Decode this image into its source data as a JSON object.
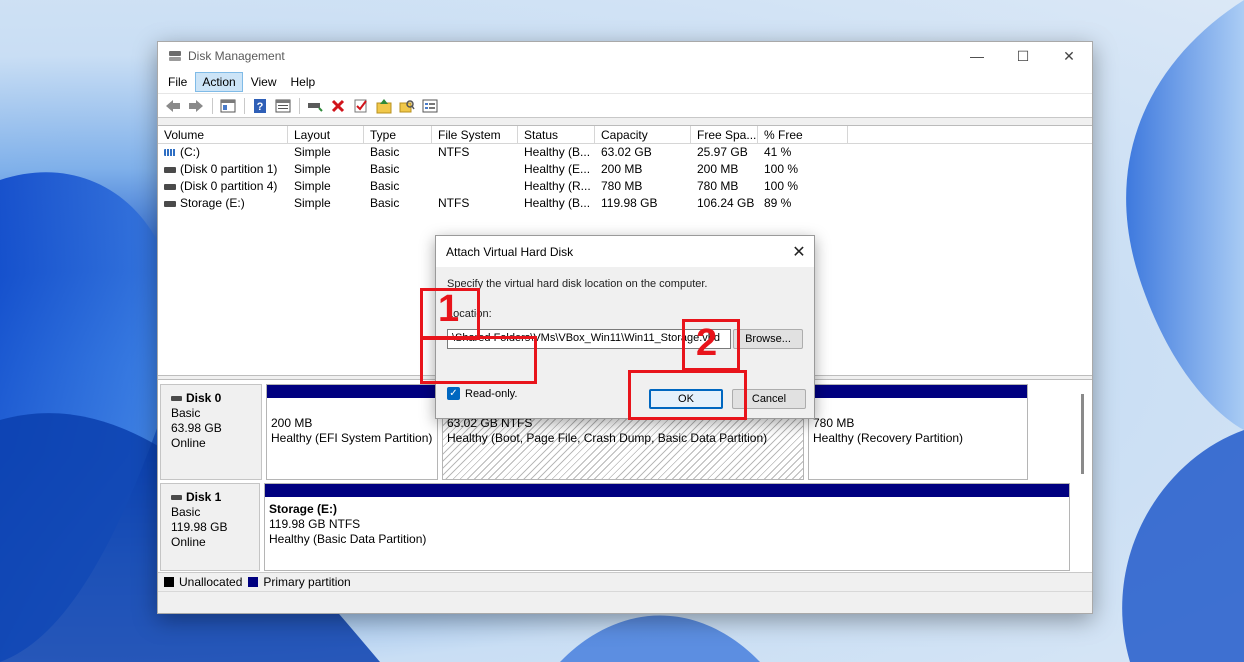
{
  "window": {
    "title": "Disk Management",
    "controls": {
      "minimize": "—",
      "maximize": "☐",
      "close": "✕"
    }
  },
  "menubar": {
    "items": [
      "File",
      "Action",
      "View",
      "Help"
    ],
    "active": "Action"
  },
  "toolbar": {
    "icons": [
      "back-arrow-icon",
      "forward-arrow-icon",
      "console-tree-icon",
      "help-icon",
      "properties-icon",
      "connect-drive-icon",
      "delete-icon",
      "check-icon",
      "folder-up-icon",
      "folder-search-icon",
      "list-view-icon"
    ]
  },
  "volume_table": {
    "columns": [
      "Volume",
      "Layout",
      "Type",
      "File System",
      "Status",
      "Capacity",
      "Free Spa...",
      "% Free"
    ],
    "rows": [
      {
        "volume": "(C:)",
        "layout": "Simple",
        "type": "Basic",
        "fs": "NTFS",
        "status": "Healthy (B...",
        "capacity": "63.02 GB",
        "free": "25.97 GB",
        "pct": "41 %"
      },
      {
        "volume": "(Disk 0 partition 1)",
        "layout": "Simple",
        "type": "Basic",
        "fs": "",
        "status": "Healthy (E...",
        "capacity": "200 MB",
        "free": "200 MB",
        "pct": "100 %"
      },
      {
        "volume": "(Disk 0 partition 4)",
        "layout": "Simple",
        "type": "Basic",
        "fs": "",
        "status": "Healthy (R...",
        "capacity": "780 MB",
        "free": "780 MB",
        "pct": "100 %"
      },
      {
        "volume": "Storage (E:)",
        "layout": "Simple",
        "type": "Basic",
        "fs": "NTFS",
        "status": "Healthy (B...",
        "capacity": "119.98 GB",
        "free": "106.24 GB",
        "pct": "89 %"
      }
    ]
  },
  "disks": [
    {
      "name": "Disk 0",
      "kind": "Basic",
      "size": "63.98 GB",
      "state": "Online",
      "partitions": [
        {
          "title": "",
          "line1": "200 MB",
          "line2": "Healthy (EFI System Partition)"
        },
        {
          "title": "",
          "line1": "63.02 GB NTFS",
          "line2": "Healthy (Boot, Page File, Crash Dump, Basic Data Partition)"
        },
        {
          "title": "",
          "line1": "780 MB",
          "line2": "Healthy (Recovery Partition)"
        }
      ]
    },
    {
      "name": "Disk 1",
      "kind": "Basic",
      "size": "119.98 GB",
      "state": "Online",
      "partitions": [
        {
          "title": "Storage  (E:)",
          "line1": "119.98 GB NTFS",
          "line2": "Healthy (Basic Data Partition)"
        }
      ]
    }
  ],
  "legend": {
    "unallocated": "Unallocated",
    "primary": "Primary partition",
    "unallocated_color": "#000000",
    "primary_color": "#000080"
  },
  "dialog": {
    "title": "Attach Virtual Hard Disk",
    "close": "✕",
    "instruction": "Specify the virtual hard disk location on the computer.",
    "location_label": "Location:",
    "location_value": "\\Shared Folders\\VMs\\VBox_Win11\\Win11_Storage.vhd",
    "browse_label": "Browse...",
    "readonly_label": "Read-only.",
    "readonly_checked": true,
    "ok_label": "OK",
    "cancel_label": "Cancel"
  },
  "annotations": {
    "step1": "1",
    "step2": "2",
    "color": "#e8141b"
  }
}
